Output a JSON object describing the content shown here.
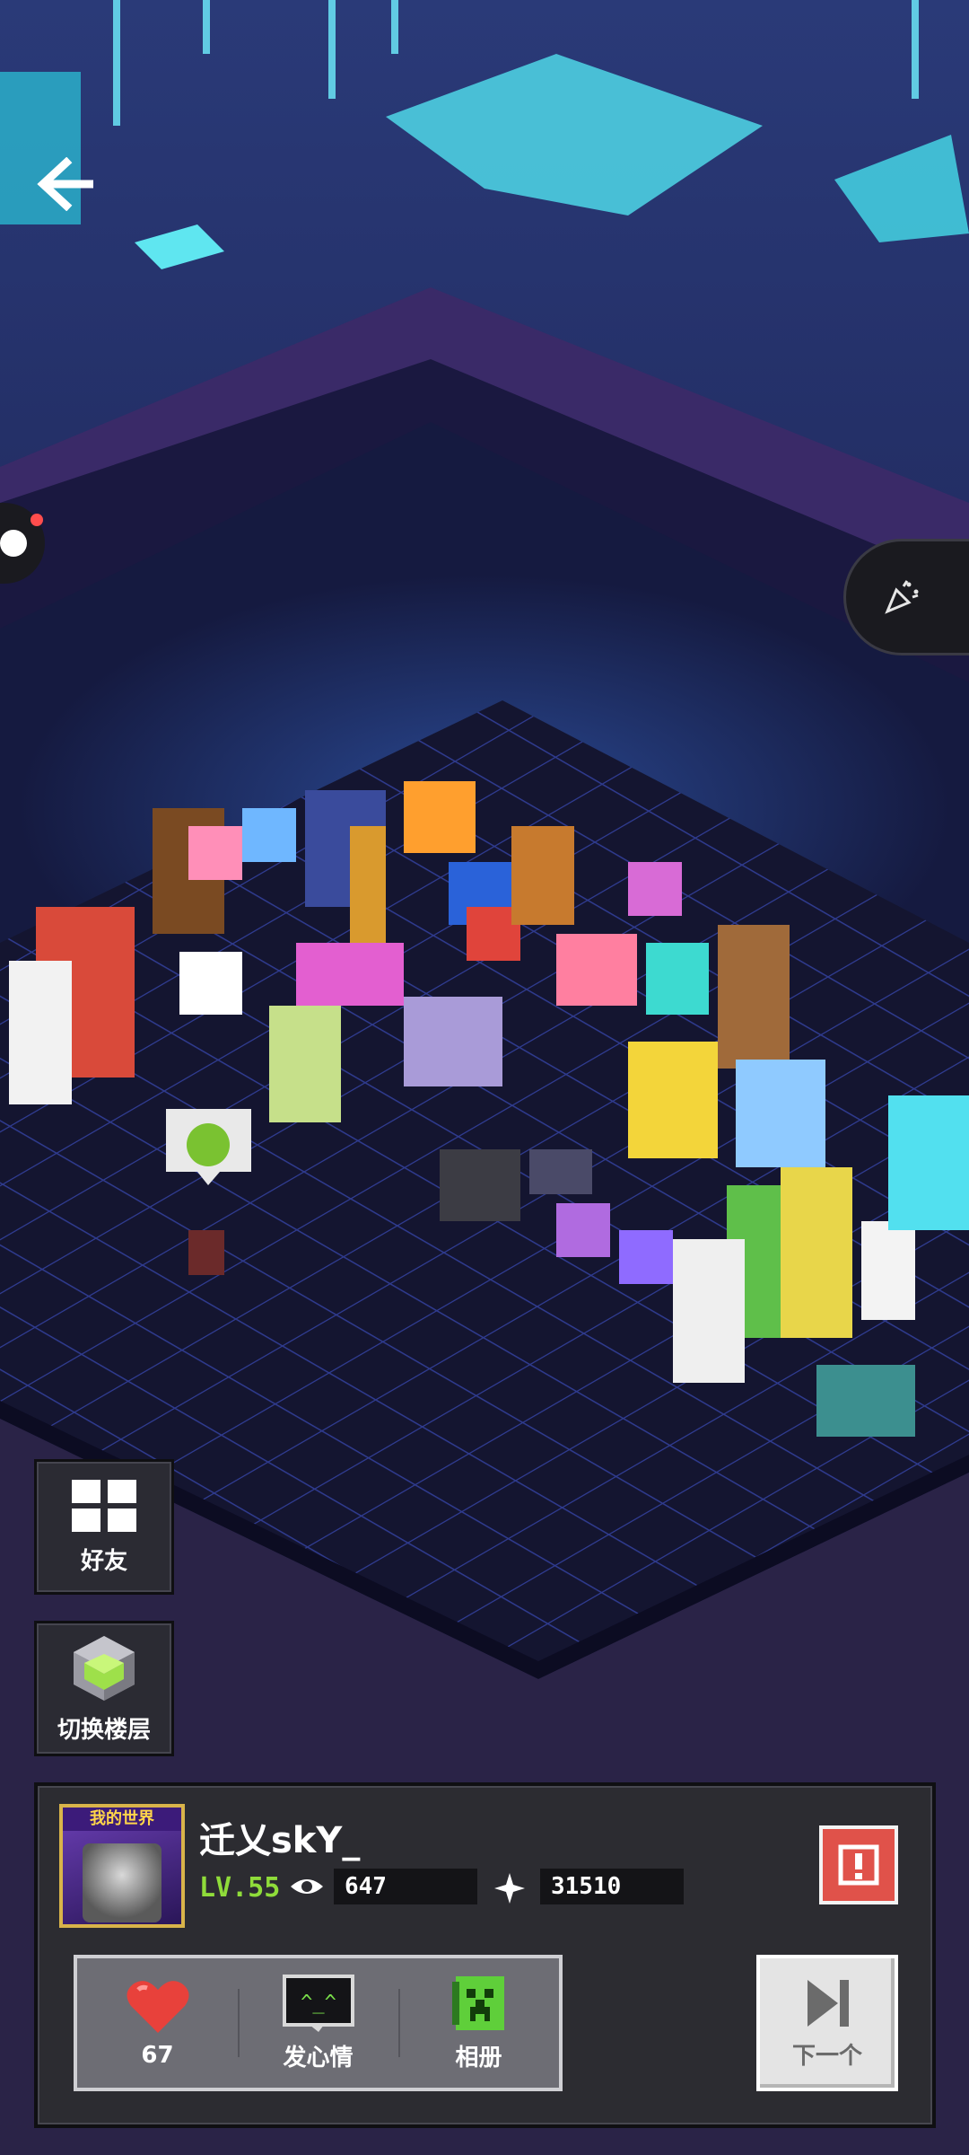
{
  "side": {
    "friends_label": "好友",
    "floor_label": "切换楼层"
  },
  "profile": {
    "avatar_banner": "我的世界",
    "username": "迁乂skY_",
    "level": "LV.55",
    "views": "647",
    "stars": "31510"
  },
  "actions": {
    "like_count": "67",
    "mood_label": "发心情",
    "album_label": "相册"
  },
  "next": {
    "label": "下一个"
  },
  "colors": {
    "level_green": "#8fdc3a",
    "report_red": "#e0524a",
    "heart_red": "#e8413b",
    "creeper_green": "#5fcf3a"
  }
}
